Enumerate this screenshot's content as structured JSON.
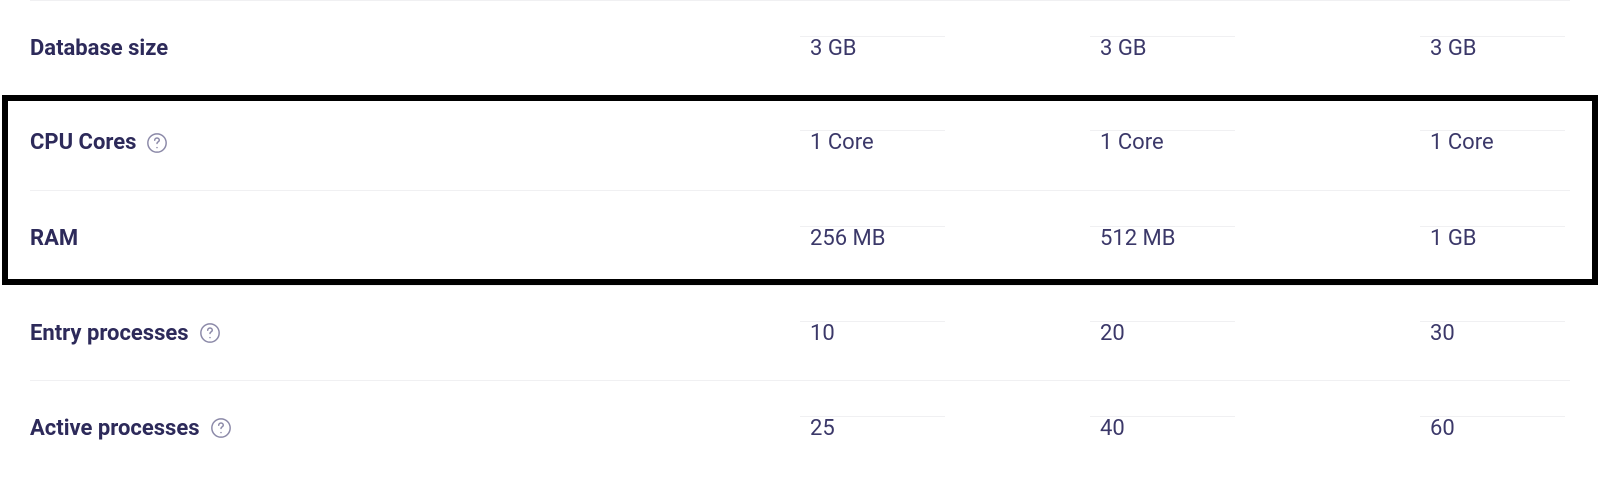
{
  "rows": [
    {
      "label": "Database size",
      "help": false,
      "values": [
        "3 GB",
        "3 GB",
        "3 GB"
      ]
    },
    {
      "label": "CPU Cores",
      "help": true,
      "values": [
        "1 Core",
        "1 Core",
        "1 Core"
      ]
    },
    {
      "label": "RAM",
      "help": false,
      "values": [
        "256 MB",
        "512 MB",
        "1 GB"
      ]
    },
    {
      "label": "Entry processes",
      "help": true,
      "values": [
        "10",
        "20",
        "30"
      ]
    },
    {
      "label": "Active processes",
      "help": true,
      "values": [
        "25",
        "40",
        "60"
      ]
    }
  ]
}
